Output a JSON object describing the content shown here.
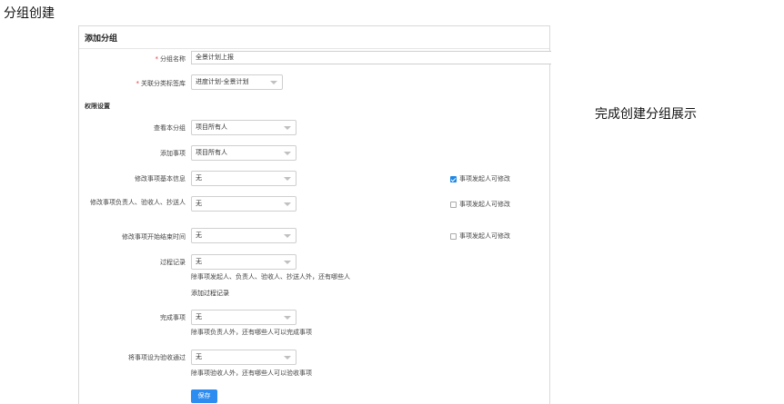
{
  "page_heading": "分组创建",
  "side_caption": "完成创建分组展示",
  "form": {
    "title": "添加分组",
    "group_name": {
      "label": "分组名称",
      "value": "全景计划上报"
    },
    "category_tag": {
      "label": "关联分类标签库",
      "value": "进度计划-全景计划"
    },
    "permission_section": "权限设置",
    "view_group": {
      "label": "查看本分组",
      "value": "项目所有人"
    },
    "add_item": {
      "label": "添加事项",
      "value": "项目所有人"
    },
    "edit_basic": {
      "label": "修改事项基本信息",
      "value": "无",
      "checkbox_label": "事项发起人可修改",
      "checked": true
    },
    "edit_people": {
      "label": "修改事项负责人、验收人、抄送人",
      "value": "无",
      "checkbox_label": "事项发起人可修改",
      "checked": false
    },
    "edit_time": {
      "label": "修改事项开始结束时间",
      "value": "无",
      "checkbox_label": "事项发起人可修改",
      "checked": false
    },
    "process_record": {
      "label": "过程记录",
      "value": "无",
      "hint": "除事项发起人、负责人、验收人、抄送人外，还有哪些人",
      "link": "添加过程记录"
    },
    "complete_item": {
      "label": "完成事项",
      "value": "无",
      "hint": "除事项负责人外，还有哪些人可以完成事项"
    },
    "accept_item": {
      "label": "将事项设为验收通过",
      "value": "无",
      "hint": "除事项验收人外，还有哪些人可以验收事项"
    },
    "save_label": "保存"
  },
  "colors": {
    "primary": "#2d8cf0",
    "required": "#e4393c",
    "checkbox": "#1e88e5"
  }
}
